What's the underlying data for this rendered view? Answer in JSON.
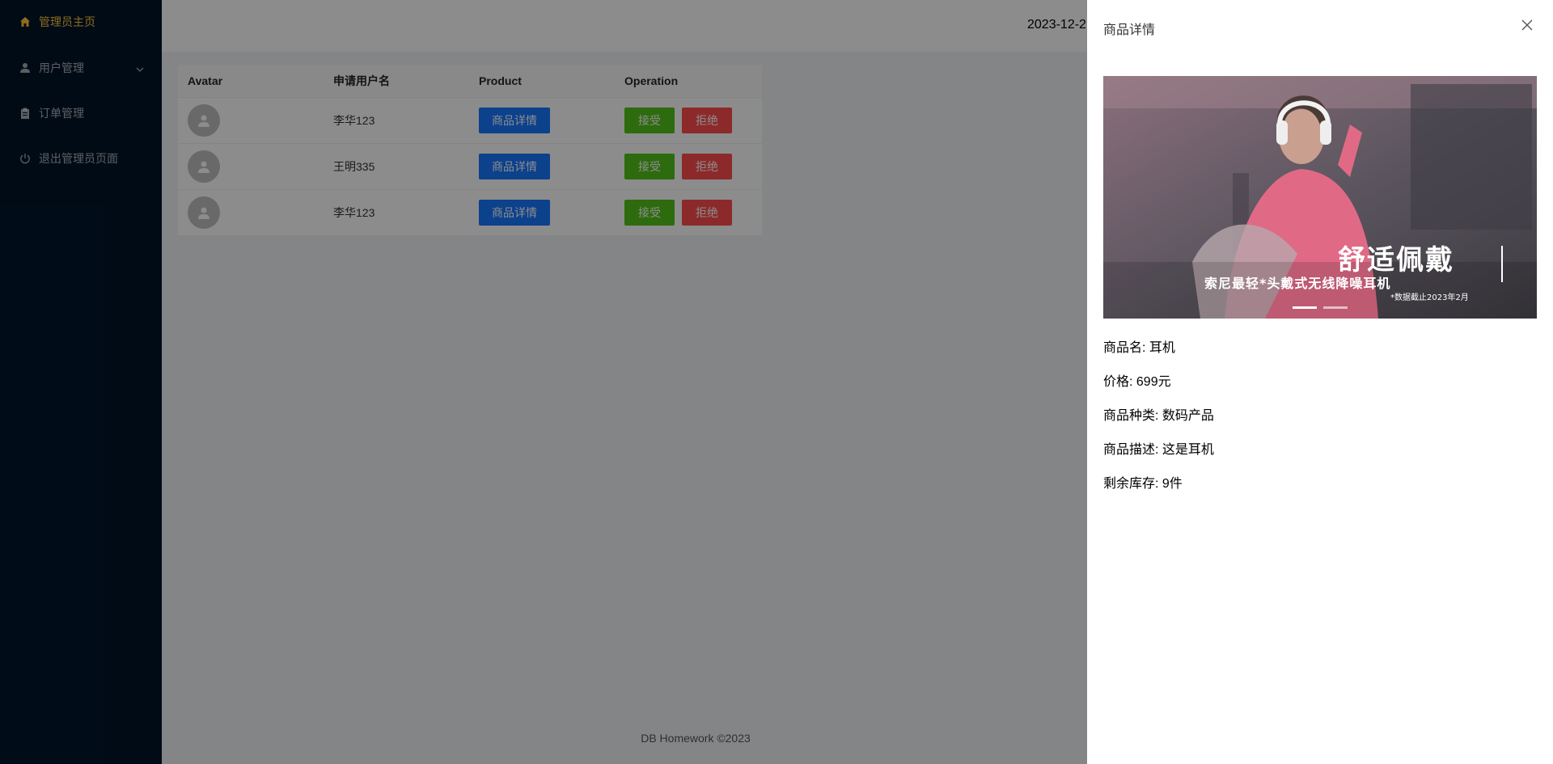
{
  "sidebar": {
    "items": [
      {
        "label": "管理员主页",
        "icon": "home-icon"
      },
      {
        "label": "用户管理",
        "icon": "user-icon"
      },
      {
        "label": "订单管理",
        "icon": "clipboard-icon"
      },
      {
        "label": "退出管理员页面",
        "icon": "power-icon"
      }
    ]
  },
  "header": {
    "date": "2023-12-2"
  },
  "table": {
    "columns": [
      "Avatar",
      "申请用户名",
      "Product",
      "Operation"
    ],
    "rows": [
      {
        "username": "李华123",
        "product_btn": "商品详情",
        "accept": "接受",
        "reject": "拒绝"
      },
      {
        "username": "王明335",
        "product_btn": "商品详情",
        "accept": "接受",
        "reject": "拒绝"
      },
      {
        "username": "李华123",
        "product_btn": "商品详情",
        "accept": "接受",
        "reject": "拒绝"
      }
    ]
  },
  "footer": "DB Homework ©2023",
  "drawer": {
    "title": "商品详情",
    "slide": {
      "headline": "舒适佩戴",
      "subline": "索尼最轻*头戴式无线降噪耳机",
      "note": "*数据截止2023年2月"
    },
    "details": [
      "商品名: 耳机",
      "价格: 699元",
      "商品种类: 数码产品",
      "商品描述: 这是耳机",
      "剩余库存: 9件"
    ]
  },
  "colors": {
    "sidebar_bg": "#001529",
    "active_menu": "#ffc53d",
    "primary": "#1677ff",
    "success": "#52c41a",
    "danger": "#ff4d4f"
  }
}
